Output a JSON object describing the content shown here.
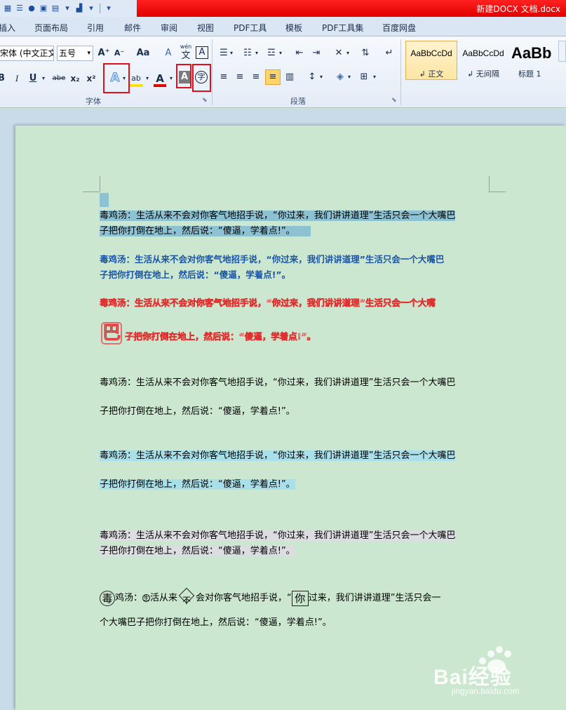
{
  "window": {
    "title": "新建DOCX 文档.docx"
  },
  "quick_access": {
    "icons": [
      "save-all-icon",
      "undo-icon",
      "globe-icon",
      "print-preview-icon",
      "image-icon",
      "layout-icon",
      "customize-icon"
    ]
  },
  "menu": {
    "tabs": [
      "插入",
      "页面布局",
      "引用",
      "邮件",
      "审阅",
      "视图",
      "PDF工具",
      "模板",
      "PDF工具集",
      "百度网盘"
    ]
  },
  "ribbon": {
    "font_name": "宋体 (中文正文)",
    "font_size": "五号",
    "grow_font": "A⁺",
    "shrink_font": "A⁻",
    "change_case": "Aa",
    "clear_format": "A",
    "phonetic_top": "wén",
    "phonetic_bottom": "文",
    "char_border": "A",
    "bold": "B",
    "italic": "I",
    "underline": "U",
    "strike": "abe",
    "subscript": "x₂",
    "superscript": "x²",
    "text_effect": "A",
    "highlight": "ab",
    "font_color": "A",
    "char_shading": "A",
    "enclose_char": "字",
    "font_group_label": "字体",
    "paragraph_group_label": "段落",
    "styles": [
      {
        "sample": "AaBbCcDd",
        "name": "↲ 正文"
      },
      {
        "sample": "AaBbCcDd",
        "name": "↲ 无间隔"
      },
      {
        "sample": "AaBb",
        "name": "标题 1"
      }
    ]
  },
  "document": {
    "p1_line1": "毒鸡汤：生活从来不会对你客气地招手说，“你过来，我们讲讲道理”生活只会一个大嘴巴",
    "p1_line2": "子把你打倒在地上，然后说：“傻逼，学着点!”。",
    "p2_line1": "毒鸡汤：生活从来不会对你客气地招手说，“你过来，我们讲讲道理”生活只会一个大嘴巴",
    "p2_line2": "子把你打倒在地上，然后说：“傻逼，学着点!”。",
    "p3_line1": "毒鸡汤：生活从来不会对你客气地招手说，“你过来，我们讲讲道理”生活只会一个大嘴",
    "p3_dropcap": "巴",
    "p3_line2": "子把你打倒在地上，然后说：“傻逼，学着点!”。",
    "p4_line1": "毒鸡汤：生活从来不会对你客气地招手说，“你过来，我们讲讲道理”生活只会一个大嘴巴",
    "p4_line2": "子把你打倒在地上，然后说：“傻逼，学着点!”。",
    "p5_line1": "毒鸡汤：生活从来不会对你客气地招手说，“你过来，我们讲讲道理”生活只会一个大嘴巴",
    "p5_line2": "子把你打倒在地上，然后说：“傻逼，学着点!”。",
    "p6_line1": "毒鸡汤：生活从来不会对你客气地招手说，“你过来，我们讲讲道理”生活只会一个大嘴巴",
    "p6_line2": "子把你打倒在地上，然后说：“傻逼，学着点!”。",
    "p7_enc1": "毒",
    "p7_text1": "鸡汤：",
    "p7_enc2": "生",
    "p7_text2": "活从来",
    "p7_enc3": "不",
    "p7_text3": "会对你客气地招手说，“",
    "p7_enc4": "你",
    "p7_text4": "过来，我们讲讲道理”生活只会一",
    "p7_line2": "个大嘴巴子把你打倒在地上，然后说：“傻逼，学着点!”。"
  },
  "watermark": {
    "brand": "Bai经验",
    "url": "jingyan.baidu.com"
  },
  "colors": {
    "title_bar": "#e00000",
    "page": "#cce7cf",
    "highlight_box": "#e0101a",
    "selection": "#8cc2d2"
  }
}
